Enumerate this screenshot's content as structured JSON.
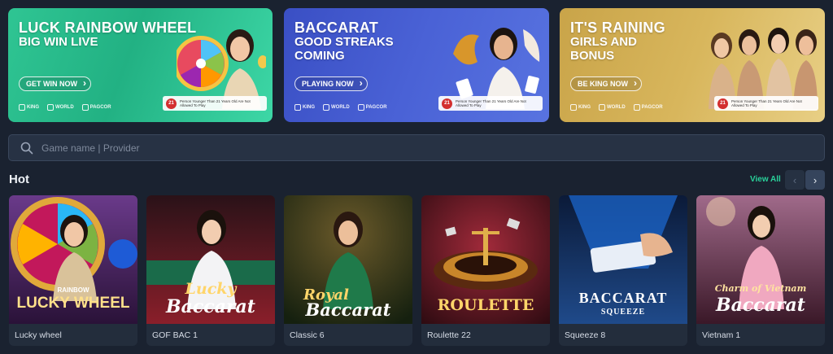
{
  "banners": [
    {
      "title": "LUCK RAINBOW WHEEL",
      "subtitle": "BIG WIN LIVE",
      "cta": "GET WIN NOW",
      "logos": [
        "KING",
        "WORLD",
        "PAGCOR"
      ],
      "age": "21",
      "age_text": "Person Younger Than 21 Years Old Are Not Allowed To Play"
    },
    {
      "title": "BACCARAT",
      "subtitle": "GOOD STREAKS COMING",
      "cta": "PLAYING NOW",
      "logos": [
        "KING",
        "WORLD",
        "PAGCOR"
      ],
      "age": "21",
      "age_text": "Person Younger Than 21 Years Old Are Not Allowed To Play"
    },
    {
      "title": "IT'S RAINING",
      "subtitle": "GIRLS AND BONUS",
      "cta": "BE KING NOW",
      "logos": [
        "KING",
        "WORLD",
        "PAGCOR"
      ],
      "age": "21",
      "age_text": "Person Younger Than 21 Years Old Are Not Allowed To Play"
    }
  ],
  "search": {
    "placeholder": "Game name | Provider",
    "icon": "search-icon"
  },
  "section": {
    "title": "Hot",
    "view_all": "View All",
    "prev_icon": "chevron-left-icon",
    "next_icon": "chevron-right-icon"
  },
  "games": [
    {
      "label": "Lucky wheel",
      "art_top": "RAINBOW",
      "art_main": "LUCKY WHEEL",
      "colors": [
        "#3a1a5c",
        "#c77d2e"
      ]
    },
    {
      "label": "GOF BAC 1",
      "art_top": "Lucky",
      "art_main": "Baccarat",
      "colors": [
        "#3d0f14",
        "#a12a2a"
      ]
    },
    {
      "label": "Classic 6",
      "art_top": "Royal",
      "art_main": "Baccarat",
      "colors": [
        "#1a2a12",
        "#6b5a2a"
      ]
    },
    {
      "label": "Roulette 22",
      "art_top": "",
      "art_main": "ROULETTE",
      "colors": [
        "#3a0a12",
        "#8a1f2a"
      ]
    },
    {
      "label": "Squeeze 8",
      "art_top": "BACCARAT",
      "art_main": "SQUEEZE",
      "colors": [
        "#0a1a3a",
        "#1f4a8a"
      ]
    },
    {
      "label": "Vietnam 1",
      "art_top": "Charm of Vietnam",
      "art_main": "Baccarat",
      "colors": [
        "#3a1a2a",
        "#b0607a"
      ]
    }
  ]
}
